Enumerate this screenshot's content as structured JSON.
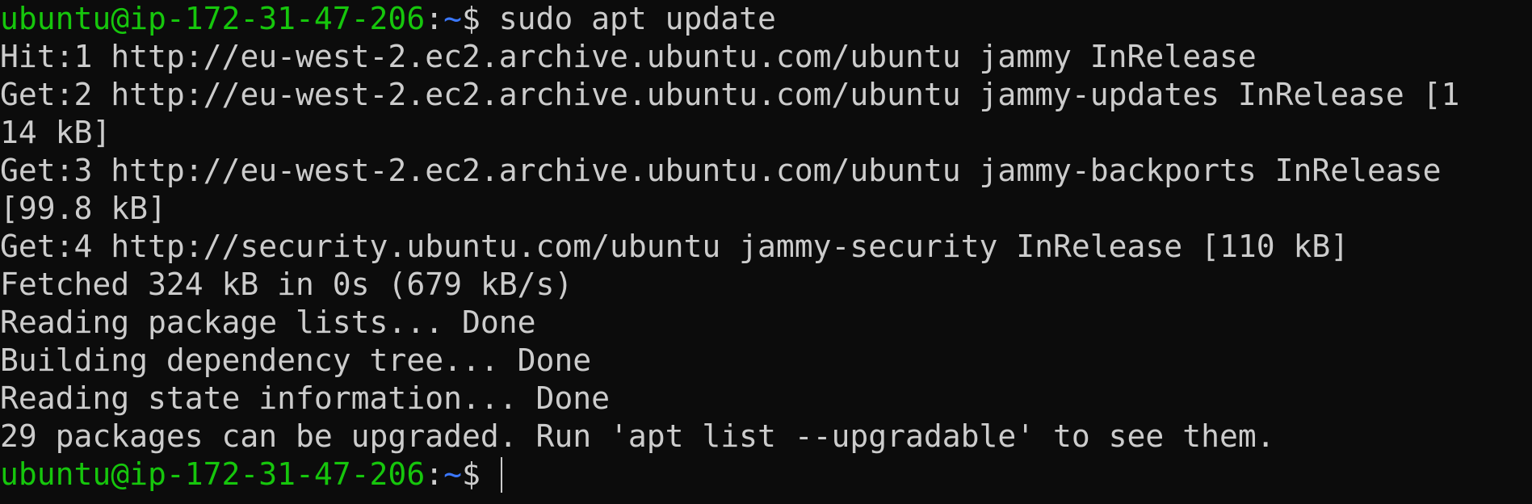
{
  "colors": {
    "background": "#0c0c0c",
    "foreground": "#cccccc",
    "prompt_user_host": "#16c60c",
    "prompt_path": "#3b78ff"
  },
  "prompt": {
    "user_host": "ubuntu@ip-172-31-47-206",
    "colon": ":",
    "path": "~",
    "symbol": "$ "
  },
  "command": "sudo apt update",
  "output_lines": [
    "Hit:1 http://eu-west-2.ec2.archive.ubuntu.com/ubuntu jammy InRelease",
    "Get:2 http://eu-west-2.ec2.archive.ubuntu.com/ubuntu jammy-updates InRelease [1",
    "14 kB]",
    "Get:3 http://eu-west-2.ec2.archive.ubuntu.com/ubuntu jammy-backports InRelease",
    "[99.8 kB]",
    "Get:4 http://security.ubuntu.com/ubuntu jammy-security InRelease [110 kB]",
    "Fetched 324 kB in 0s (679 kB/s)",
    "Reading package lists... Done",
    "Building dependency tree... Done",
    "Reading state information... Done",
    "29 packages can be upgraded. Run 'apt list --upgradable' to see them."
  ]
}
